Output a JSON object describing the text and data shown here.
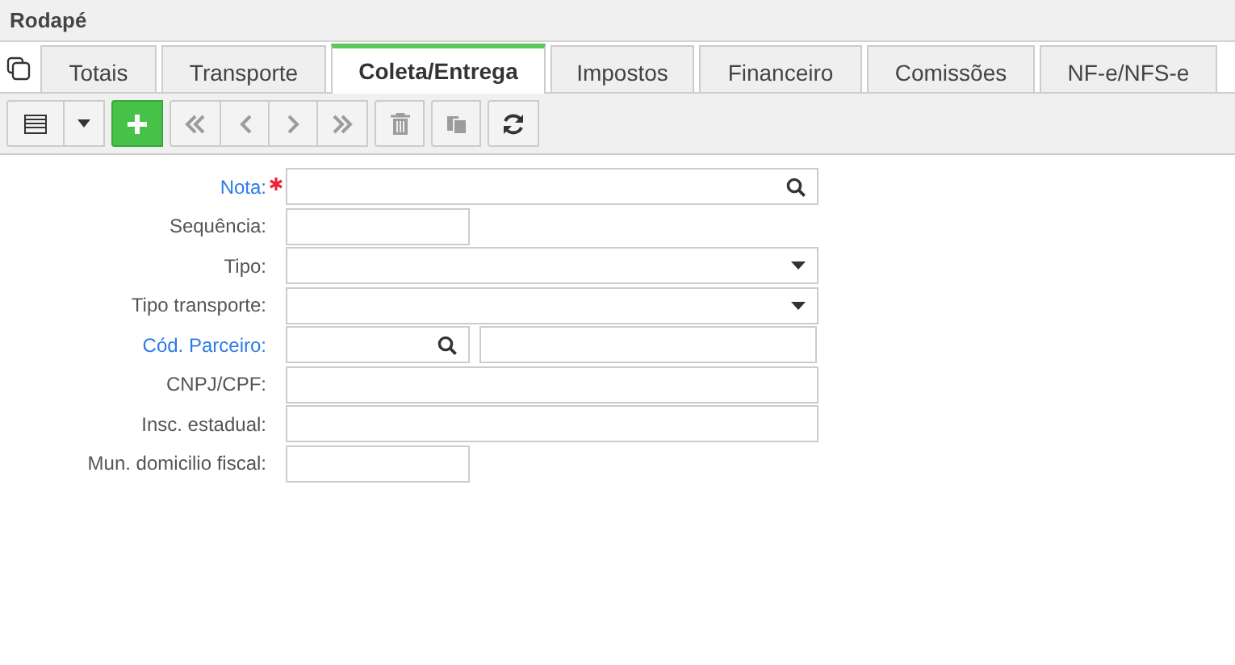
{
  "panel": {
    "title": "Rodapé"
  },
  "tabs": [
    {
      "label": "Totais",
      "selected": false
    },
    {
      "label": "Transporte",
      "selected": false
    },
    {
      "label": "Coleta/Entrega",
      "selected": true
    },
    {
      "label": "Impostos",
      "selected": false
    },
    {
      "label": "Financeiro",
      "selected": false
    },
    {
      "label": "Comissões",
      "selected": false
    },
    {
      "label": "NF-e/NFS-e",
      "selected": false
    }
  ],
  "toolbar": [
    [
      {
        "kind": "grid",
        "disabled": false
      },
      {
        "kind": "caret",
        "disabled": false
      }
    ],
    [
      {
        "kind": "add",
        "disabled": false
      }
    ],
    [
      {
        "kind": "first",
        "disabled": true
      },
      {
        "kind": "prev",
        "disabled": true
      },
      {
        "kind": "next",
        "disabled": true
      },
      {
        "kind": "last",
        "disabled": true
      }
    ],
    [
      {
        "kind": "delete",
        "disabled": true
      }
    ],
    [
      {
        "kind": "copy",
        "disabled": true
      }
    ],
    [
      {
        "kind": "refresh",
        "disabled": false
      }
    ]
  ],
  "form": [
    {
      "label": "Nota:",
      "kind": "lookup",
      "link": true,
      "required": true
    },
    {
      "label": "Sequência:",
      "kind": "short_text",
      "link": false,
      "required": false
    },
    {
      "label": "Tipo:",
      "kind": "select",
      "link": false,
      "required": false
    },
    {
      "label": "Tipo transporte:",
      "kind": "select",
      "link": false,
      "required": false
    },
    {
      "label": "Cód. Parceiro:",
      "kind": "lookup_pair",
      "link": true,
      "required": false
    },
    {
      "label": "CNPJ/CPF:",
      "kind": "text",
      "link": false,
      "required": false
    },
    {
      "label": "Insc. estadual:",
      "kind": "text",
      "link": false,
      "required": false
    },
    {
      "label": "Mun. domicilio fiscal:",
      "kind": "short_text",
      "link": false,
      "required": false
    }
  ]
}
